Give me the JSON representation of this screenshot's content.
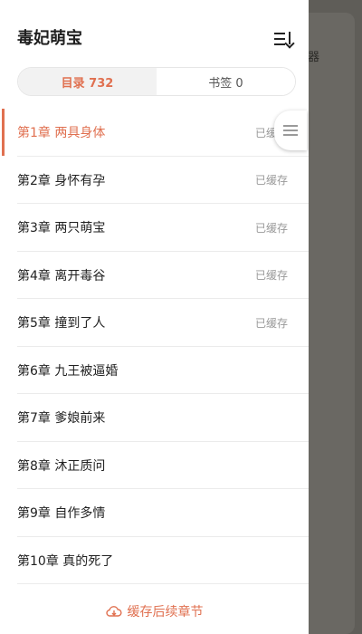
{
  "background": {
    "text_fragment": "器"
  },
  "header": {
    "title": "毒妃萌宝"
  },
  "tabs": [
    {
      "label": "目录 732"
    },
    {
      "label": "书签 0"
    }
  ],
  "chapters": [
    {
      "title": "第1章 两具身体",
      "status": "已缓存"
    },
    {
      "title": "第2章 身怀有孕",
      "status": "已缓存"
    },
    {
      "title": "第3章 两只萌宝",
      "status": "已缓存"
    },
    {
      "title": "第4章 离开毒谷",
      "status": "已缓存"
    },
    {
      "title": "第5章 撞到了人",
      "status": "已缓存"
    },
    {
      "title": "第6章 九王被逼婚",
      "status": ""
    },
    {
      "title": "第7章 爹娘前来",
      "status": ""
    },
    {
      "title": "第8章 沐正质问",
      "status": ""
    },
    {
      "title": "第9章 自作多情",
      "status": ""
    },
    {
      "title": "第10章 真的死了",
      "status": ""
    }
  ],
  "footer": {
    "label": "缓存后续章节"
  },
  "colors": {
    "accent": "#e07050",
    "cached": "#999999"
  }
}
